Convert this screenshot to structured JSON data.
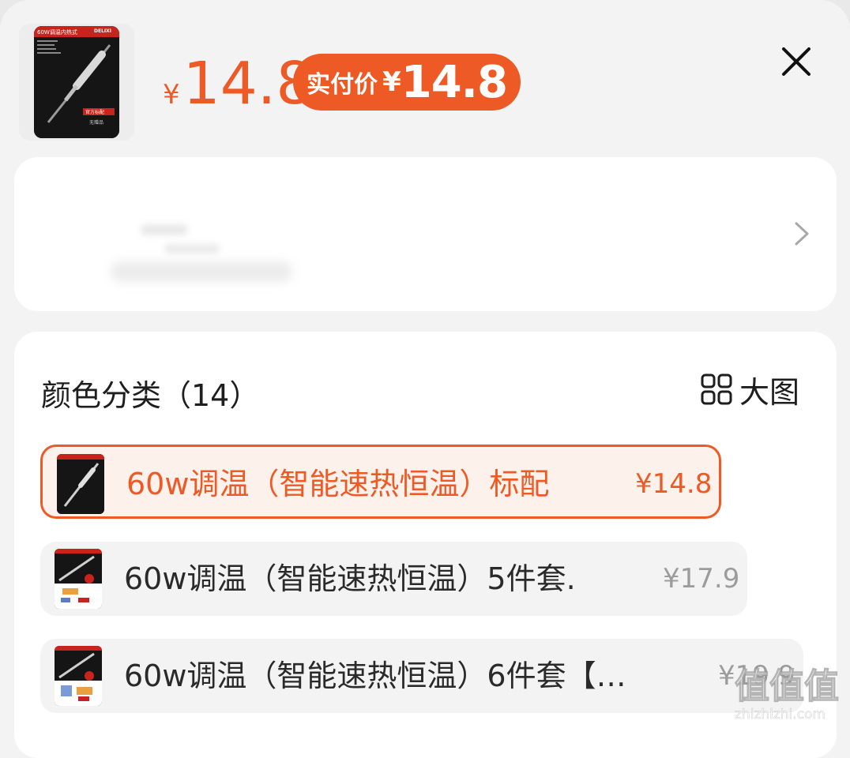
{
  "header": {
    "currency": "¥",
    "price": "14.8",
    "paid_label": "实付价",
    "paid_currency": "¥",
    "paid_value": "14.8",
    "thumb": {
      "brand_tag": "DELIXI",
      "title_text": "60W调温内热式",
      "badge_text": "官方标配",
      "badge_sub": "无赠品"
    }
  },
  "section": {
    "title": "颜色分类（14）",
    "bigview_label": "大图"
  },
  "variants": [
    {
      "name": "60w调温（智能速热恒温）标配",
      "price": "¥14.8",
      "selected": true
    },
    {
      "name": "60w调温（智能速热恒温）5件套.",
      "price": "¥17.9",
      "selected": false
    },
    {
      "name": "60w调温（智能速热恒温）6件套【…",
      "price": "¥19.9",
      "selected": false
    }
  ],
  "icons": {
    "close": "close-icon",
    "chevron": "chevron-right-icon",
    "grid": "grid-icon"
  },
  "colors": {
    "accent": "#ee5a26",
    "sheet_bg": "#f3f3f3",
    "card_bg": "#ffffff"
  },
  "watermark": {
    "glyphs": "值值值",
    "site": "zhizhizhi.com"
  }
}
